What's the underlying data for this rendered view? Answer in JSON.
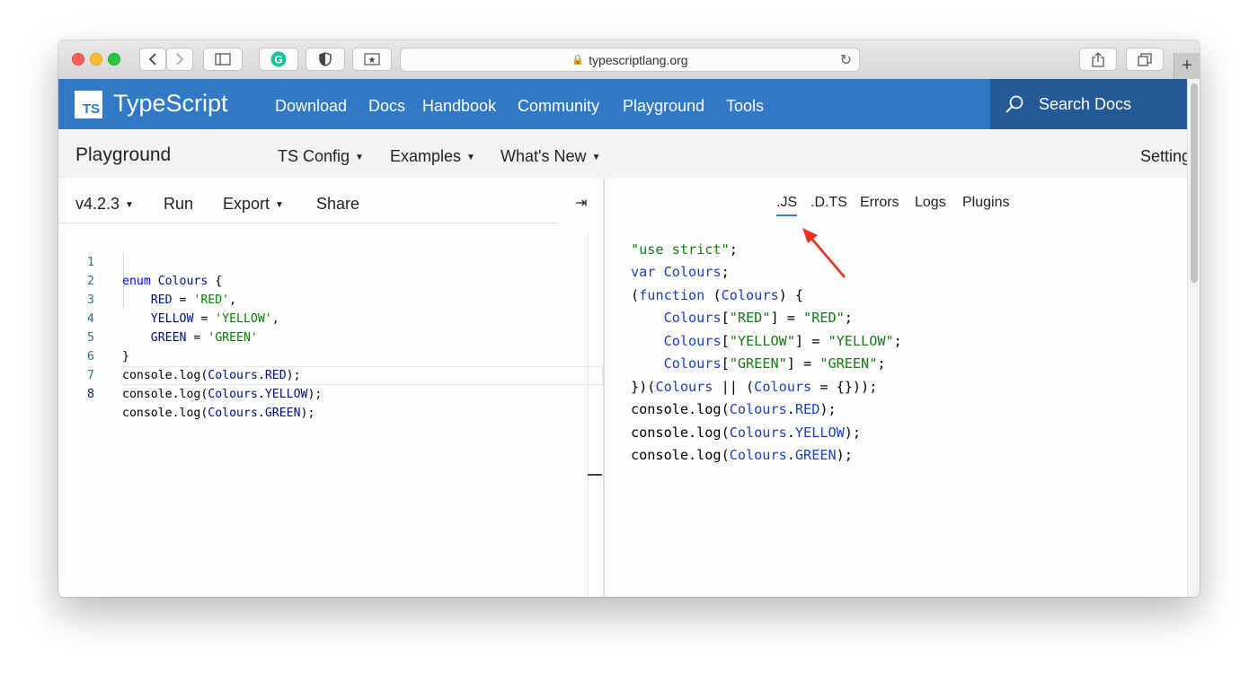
{
  "browser": {
    "url": "typescriptlang.org"
  },
  "site": {
    "logo_text": "TS",
    "name": "TypeScript",
    "nav": [
      "Download",
      "Docs",
      "Handbook",
      "Community",
      "Playground",
      "Tools"
    ],
    "search_label": "Search Docs",
    "brand_color": "#3178c6"
  },
  "playground": {
    "title": "Playground",
    "menus": [
      "TS Config",
      "Examples",
      "What's New"
    ],
    "settings_label": "Settings",
    "version": "v4.2.3",
    "run_label": "Run",
    "export_label": "Export",
    "share_label": "Share",
    "collapse_icon": "⇥"
  },
  "editor": {
    "line_numbers": [
      "1",
      "2",
      "3",
      "4",
      "5",
      "6",
      "7",
      "8"
    ],
    "lines": [
      "enum Colours {",
      "    RED = 'RED',",
      "    YELLOW = 'YELLOW',",
      "    GREEN = 'GREEN'",
      "}",
      "console.log(Colours.RED);",
      "console.log(Colours.YELLOW);",
      "console.log(Colours.GREEN);"
    ],
    "active_line": 8
  },
  "output": {
    "tabs": [
      ".JS",
      ".D.TS",
      "Errors",
      "Logs",
      "Plugins"
    ],
    "active_tab": ".JS",
    "lines": [
      "\"use strict\";",
      "var Colours;",
      "(function (Colours) {",
      "    Colours[\"RED\"] = \"RED\";",
      "    Colours[\"YELLOW\"] = \"YELLOW\";",
      "    Colours[\"GREEN\"] = \"GREEN\";",
      "})(Colours || (Colours = {}));",
      "console.log(Colours.RED);",
      "console.log(Colours.YELLOW);",
      "console.log(Colours.GREEN);"
    ]
  },
  "annotation": {
    "arrow_color": "#e8321e"
  }
}
